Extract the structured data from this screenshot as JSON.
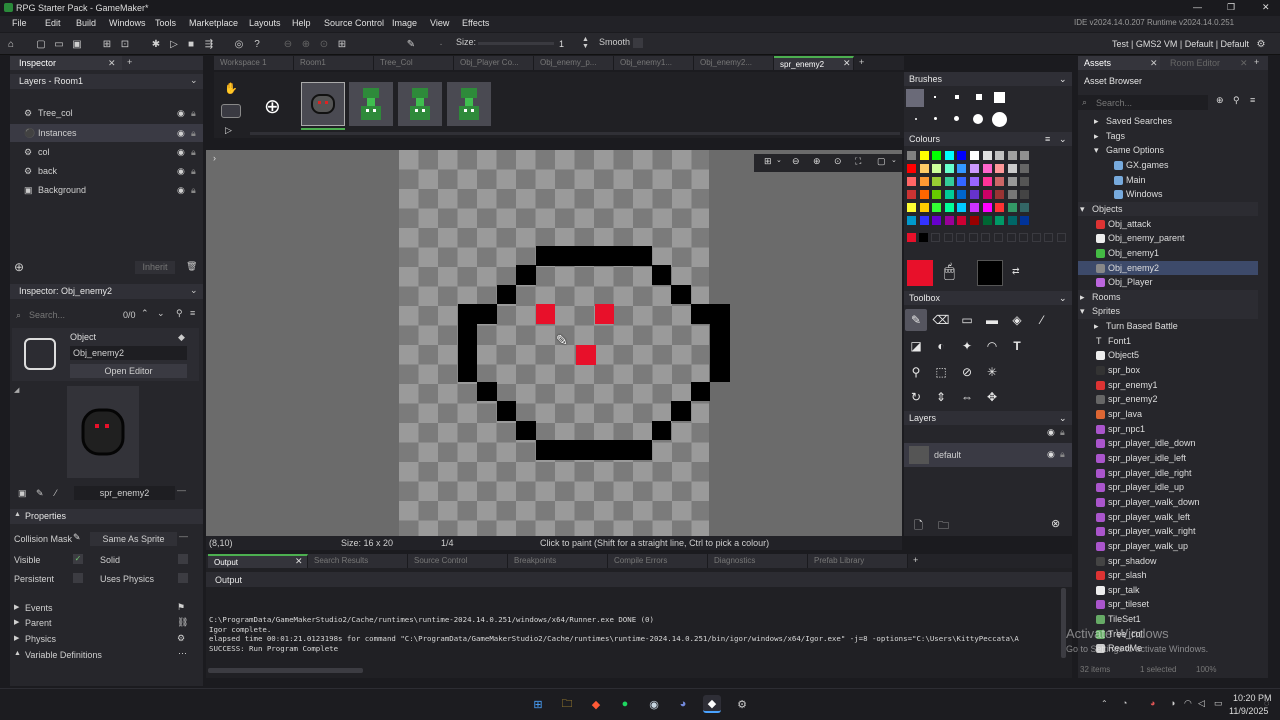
{
  "window": {
    "title": "RPG Starter Pack - GameMaker*",
    "min": "—",
    "max": "❐",
    "close": "✕"
  },
  "menu": [
    "File",
    "Edit",
    "Build",
    "Windows",
    "Tools",
    "Marketplace",
    "Layouts",
    "Help",
    "Source Control",
    "Image",
    "View",
    "Effects"
  ],
  "ide_version": "IDE v2024.14.0.207  Runtime v2024.14.0.251",
  "toolbar": {
    "size_label": "Size:",
    "size_value": "1",
    "smooth_label": "Smooth",
    "targets": "Test | GMS2 VM | Default | Default"
  },
  "inspector": {
    "tab": "Inspector",
    "layers_header": "Layers - Room1",
    "layers": [
      "Tree_col",
      "Instances",
      "col",
      "back",
      "Background"
    ],
    "inherit_label": "Inherit",
    "obj_header": "Inspector: Obj_enemy2",
    "search_placeholder": "Search...",
    "count": "0/0",
    "object_label": "Object",
    "object_name": "Obj_enemy2",
    "open_editor": "Open Editor",
    "sprite_name": "spr_enemy2",
    "properties_label": "Properties",
    "collision_mask_label": "Collision Mask",
    "collision_mask_value": "Same As Sprite",
    "visible_label": "Visible",
    "solid_label": "Solid",
    "persistent_label": "Persistent",
    "uses_physics_label": "Uses Physics",
    "sections": [
      "Events",
      "Parent",
      "Physics",
      "Variable Definitions"
    ]
  },
  "editor_tabs": [
    "Workspace 1",
    "Room1",
    "Tree_Col",
    "Obj_Player Co...",
    "Obj_enemy_p...",
    "Obj_enemy1...",
    "Obj_enemy2...",
    "spr_enemy2"
  ],
  "status": {
    "coords": "(8,10)",
    "size": "Size: 16 x 20",
    "frame": "1/4",
    "hint": "Click to paint (Shift for a straight line, Ctrl to pick a colour)"
  },
  "output": {
    "tabs": [
      "Output",
      "Search Results",
      "Source Control",
      "Breakpoints",
      "Compile Errors",
      "Diagnostics",
      "Prefab Library"
    ],
    "title": "Output",
    "lines": [
      "C:\\ProgramData/GameMakerStudio2/Cache/runtimes\\runtime-2024.14.0.251/windows/x64/Runner.exe DONE (0)",
      "Igor complete.",
      "elapsed time 00:01:21.0123198s for command \"C:\\ProgramData/GameMakerStudio2/Cache/runtimes\\runtime-2024.14.0.251/bin/igor/windows/x64/Igor.exe\" -j=8  -options=\"C:\\Users\\KittyPeccata\\A",
      "SUCCESS: Run Program Complete"
    ]
  },
  "side": {
    "brushes": "Brushes",
    "colours": "Colours",
    "toolbox": "Toolbox",
    "layers": "Layers",
    "layer_default": "default"
  },
  "palette": [
    "#808080",
    "#ffff00",
    "#00ff00",
    "#00ffff",
    "#0000ff",
    "#ffffff",
    "#e0e0e0",
    "#c0c0c0",
    "#a0a0a0",
    "#909090",
    "#ff0000",
    "#ffcc66",
    "#ccff99",
    "#66ffcc",
    "#3399ff",
    "#cc99ff",
    "#ff66cc",
    "#ff9999",
    "#cccccc",
    "#666666",
    "#ff6666",
    "#ff9933",
    "#99cc33",
    "#33cc99",
    "#3366ff",
    "#9966ff",
    "#ff3399",
    "#cc6666",
    "#999999",
    "#555555",
    "#cc3333",
    "#ff6600",
    "#66cc00",
    "#00cc99",
    "#0066cc",
    "#6633cc",
    "#cc0066",
    "#993333",
    "#777777",
    "#444444",
    "#ffff33",
    "#ffcc00",
    "#33ff33",
    "#00ff99",
    "#00ccff",
    "#cc33ff",
    "#ff00ff",
    "#ff3333",
    "#339966",
    "#336666",
    "#0099cc",
    "#3333ff",
    "#6600cc",
    "#990099",
    "#cc0033",
    "#990000",
    "#006633",
    "#009966",
    "#006666",
    "#003399"
  ],
  "primary_colour": "#e8102a",
  "secondary_colour": "#000000",
  "assets": {
    "tab": "Assets",
    "tab2": "Room Editor",
    "browser": "Asset Browser",
    "search_placeholder": "Search...",
    "items": [
      "Saved Searches",
      "Tags",
      "Game Options",
      "GX.games",
      "Main",
      "Windows",
      "Objects",
      "Obj_attack",
      "Obj_enemy_parent",
      "Obj_enemy1",
      "Obj_enemy2",
      "Obj_Player",
      "Rooms",
      "Sprites",
      "Turn Based Battle",
      "Font1",
      "Object5",
      "spr_box",
      "spr_enemy1",
      "spr_enemy2",
      "spr_lava",
      "spr_npc1",
      "spr_player_idle_down",
      "spr_player_idle_left",
      "spr_player_idle_right",
      "spr_player_idle_up",
      "spr_player_walk_down",
      "spr_player_walk_left",
      "spr_player_walk_right",
      "spr_player_walk_up",
      "spr_shadow",
      "spr_slash",
      "spr_talk",
      "spr_tileset",
      "TileSet1",
      "Tree_col",
      "ReadMe"
    ],
    "footer_items": "32 items",
    "footer_sel": "1 selected",
    "zoom": "100%"
  },
  "watermark": {
    "line1": "Activate Windows",
    "line2": "Go to Settings to activate Windows."
  },
  "taskbar": {
    "time": "10:20 PM",
    "date": "11/9/2025"
  }
}
